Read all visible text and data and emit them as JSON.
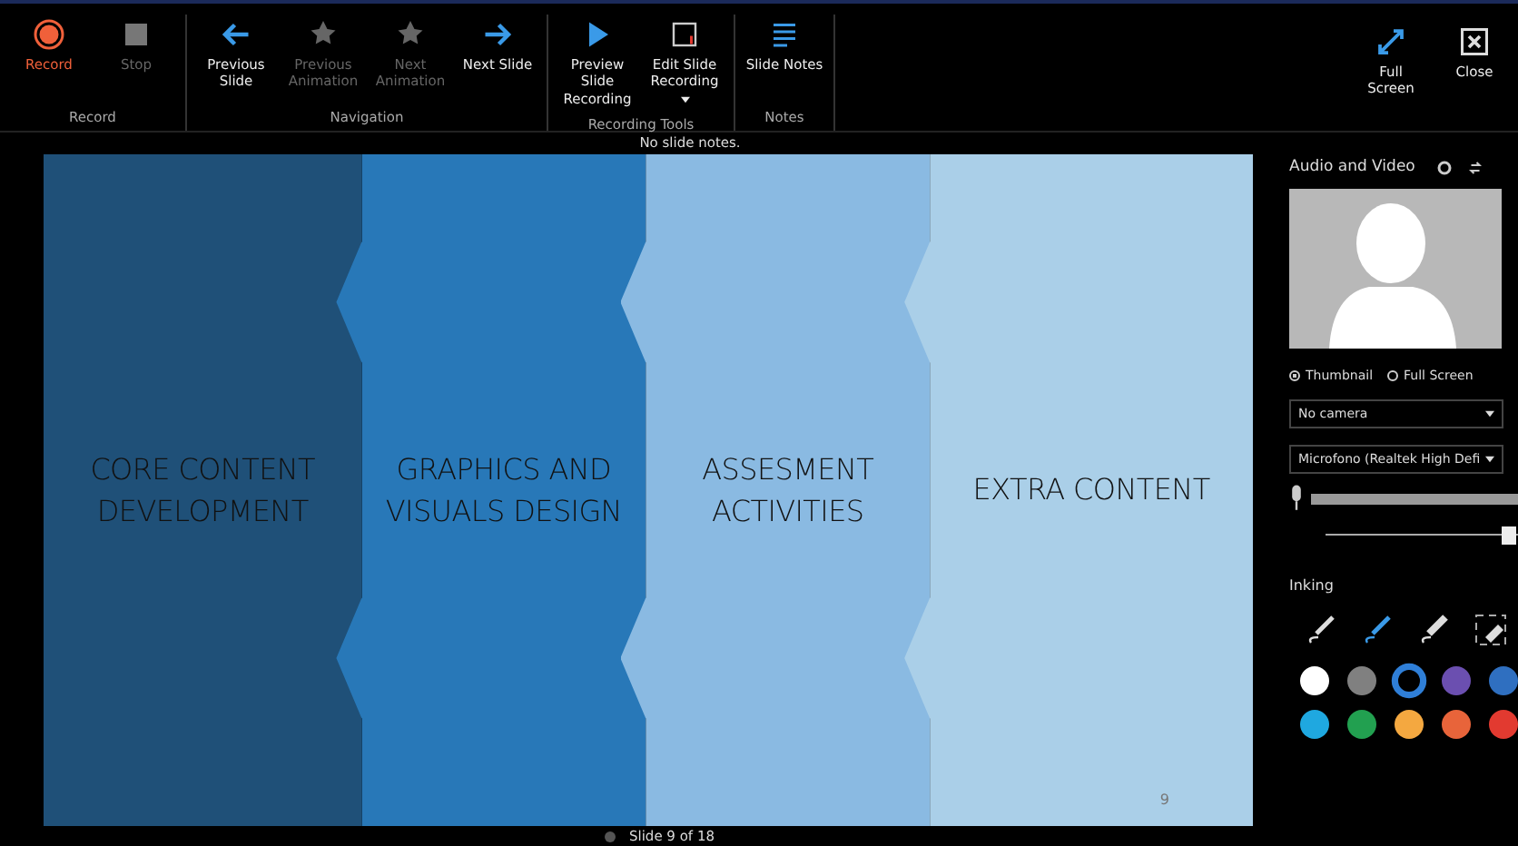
{
  "toolbar": {
    "groups": [
      {
        "label": "Record",
        "buttons": [
          {
            "kind": "record",
            "label": "Record",
            "disabled": false
          },
          {
            "kind": "stop",
            "label": "Stop",
            "disabled": true
          }
        ]
      },
      {
        "label": "Navigation",
        "buttons": [
          {
            "kind": "left",
            "label": "Previous Slide",
            "disabled": false
          },
          {
            "kind": "star-left",
            "label": "Previous Animation",
            "disabled": true
          },
          {
            "kind": "star-right",
            "label": "Next Animation",
            "disabled": true
          },
          {
            "kind": "right",
            "label": "Next Slide",
            "disabled": false
          }
        ]
      },
      {
        "label": "Recording Tools",
        "buttons": [
          {
            "kind": "play",
            "label": "Preview Slide Recording",
            "disabled": false
          },
          {
            "kind": "edit",
            "label": "Edit Slide Recording",
            "disabled": false,
            "dropdown": true
          }
        ]
      },
      {
        "label": "Notes",
        "buttons": [
          {
            "kind": "notes",
            "label": "Slide Notes",
            "disabled": false
          }
        ]
      }
    ],
    "right_buttons": [
      {
        "kind": "fullscreen",
        "label": "Full Screen"
      },
      {
        "kind": "close",
        "label": "Close"
      }
    ]
  },
  "notes": "No slide notes.",
  "slide": {
    "columns": [
      {
        "text": "CORE CONTENT DEVELOPMENT",
        "color": "#1f5078"
      },
      {
        "text": "GRAPHICS AND VISUALS DESIGN",
        "color": "#2878b8"
      },
      {
        "text": "ASSESMENT ACTIVITIES",
        "color": "#8abae2"
      },
      {
        "text": "EXTRA CONTENT",
        "color": "#aacfe8"
      }
    ],
    "number": "9"
  },
  "panel": {
    "title": "Audio and Video",
    "view_options": [
      {
        "label": "Thumbnail",
        "selected": true
      },
      {
        "label": "Full Screen",
        "selected": false
      }
    ],
    "camera": "No camera",
    "microphone": "Microfono (Realtek High Defi",
    "mic_level": {
      "level": 1
    },
    "volume": {
      "level": 0.95
    },
    "inking_title": "Inking",
    "ink_tools": [
      {
        "kind": "pen",
        "selected": false
      },
      {
        "kind": "pen",
        "selected": true
      },
      {
        "kind": "highlighter",
        "selected": false
      },
      {
        "kind": "eraser",
        "selected": false
      }
    ],
    "ink_colors": [
      {
        "color": "#ffffff",
        "selected": false
      },
      {
        "color": "#808080",
        "selected": false
      },
      {
        "color": "#000000",
        "selected": true
      },
      {
        "color": "#6b4fb0",
        "selected": false
      },
      {
        "color": "#2f6fc0",
        "selected": false
      },
      {
        "color": "#1fa8e0",
        "selected": false
      },
      {
        "color": "#22a050",
        "selected": false
      },
      {
        "color": "#f4a840",
        "selected": false
      },
      {
        "color": "#e8643a",
        "selected": false
      },
      {
        "color": "#e23a30",
        "selected": false
      }
    ]
  },
  "status": "Slide 9 of 18"
}
